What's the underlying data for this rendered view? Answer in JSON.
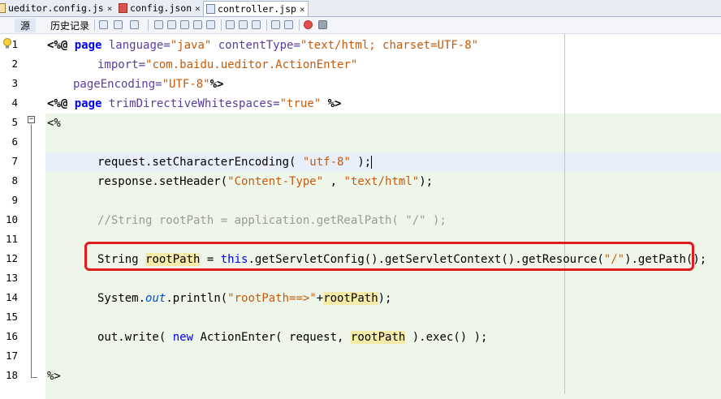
{
  "tabs": [
    {
      "label": "ueditor.config.js",
      "close": "×"
    },
    {
      "label": "config.json",
      "close": "×"
    },
    {
      "label": "controller.jsp",
      "close": "×"
    }
  ],
  "toolbar": {
    "source": "源",
    "history": "历史记录"
  },
  "line_numbers": [
    "1",
    "2",
    "3",
    "4",
    "5",
    "6",
    "7",
    "8",
    "9",
    "10",
    "11",
    "12",
    "13",
    "14",
    "15",
    "16",
    "17",
    "18"
  ],
  "code": {
    "l1": {
      "a": "<%@",
      "b": " page",
      "c": " language=",
      "d": "\"java\"",
      "e": " contentType=",
      "f": "\"text/html; charset=UTF-8\""
    },
    "l2": {
      "a": "import=",
      "b": "\"com.baidu.ueditor.ActionEnter\""
    },
    "l3": {
      "a": "pageEncoding=",
      "b": "\"UTF-8\"",
      "c": "%>"
    },
    "l4": {
      "a": "<%@",
      "b": " page",
      "c": " trimDirectiveWhitespaces=",
      "d": "\"true\"",
      "e": " %>"
    },
    "l5": {
      "a": "<%"
    },
    "l7": {
      "a": "request.setCharacterEncoding( ",
      "b": "\"utf-8\"",
      "c": " );"
    },
    "l8": {
      "a": "response.setHeader(",
      "b": "\"Content-Type\"",
      "c": " , ",
      "d": "\"text/html\"",
      "e": ");"
    },
    "l10": {
      "a": "//String rootPath = application.getRealPath( \"/\" );"
    },
    "l12": {
      "a": "String ",
      "b": "rootPath",
      "c": " = ",
      "d": "this",
      "e": ".getServletConfig().getServletContext().getResource(",
      "f": "\"/\"",
      "g": ").getPath();"
    },
    "l14": {
      "a": "System.",
      "b": "out",
      "c": ".println(",
      "d": "\"rootPath==>\"",
      "e": "+",
      "f": "rootPath",
      "g": ");"
    },
    "l16": {
      "a": "out.write( ",
      "b": "new",
      "c": " ActionEnter( request, ",
      "d": "rootPath",
      "e": " ).exec() );"
    },
    "l18": {
      "a": "%>"
    }
  },
  "colors": {
    "keyword": "#0000ee",
    "string": "#c85a0a",
    "comment": "#9a9a9a",
    "highlight_box": "#e21b1b"
  }
}
